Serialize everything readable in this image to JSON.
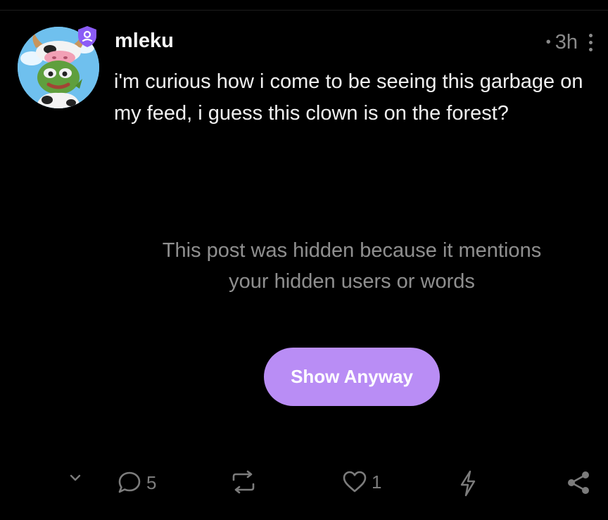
{
  "post": {
    "username": "mleku",
    "time": "3h",
    "text": "i'm curious how i come to be seeing this garbage on my feed, i guess this clown is on the forest?"
  },
  "hidden": {
    "message": "This post was hidden because it mentions your hidden users or words",
    "button_label": "Show Anyway",
    "button_color": "#b98df5"
  },
  "actions": {
    "replies": "5",
    "likes": "1"
  },
  "icons": [
    "verified-badge-icon",
    "more-options-icon",
    "chevron-down-icon",
    "reply-icon",
    "repost-icon",
    "heart-icon",
    "zap-icon",
    "share-icon"
  ]
}
